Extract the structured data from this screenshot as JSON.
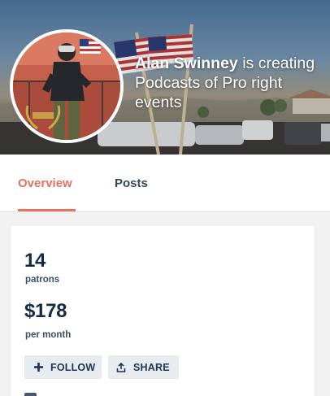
{
  "hero": {
    "creator_name": "Alan Swinney",
    "tagline": " is creating Podcasts of Pro right events"
  },
  "tabs": [
    {
      "label": "Overview",
      "active": true
    },
    {
      "label": "Posts",
      "active": false
    }
  ],
  "stats": {
    "patrons_count": "14",
    "patrons_label": "patrons",
    "earnings_amount": "$178",
    "earnings_label": "per month"
  },
  "actions": {
    "follow_label": "FOLLOW",
    "follow_icon": "plus-icon",
    "share_label": "SHARE",
    "share_icon": "share-upload-icon"
  },
  "colors": {
    "accent": "#e8705f",
    "heading": "#142b45",
    "button_bg": "#e8ebef",
    "page_bg": "#f2f2f2"
  }
}
